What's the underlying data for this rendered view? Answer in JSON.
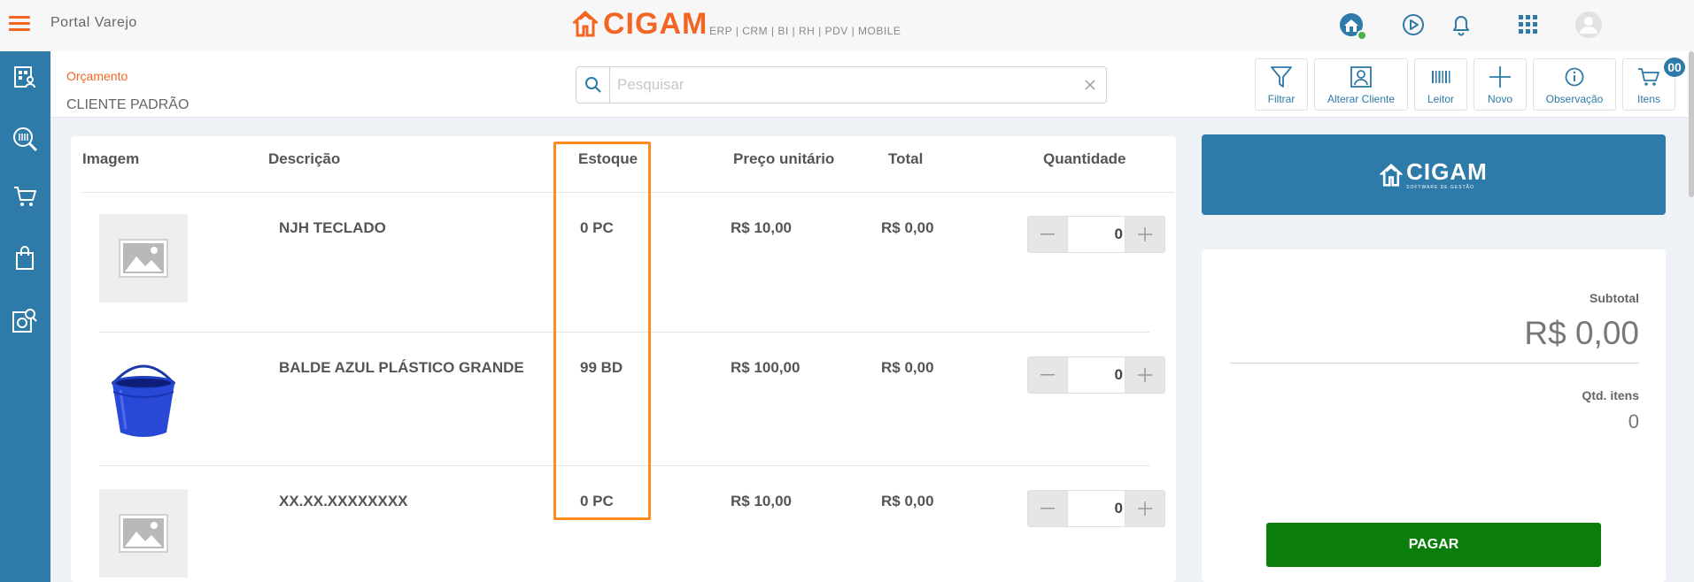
{
  "header": {
    "portal_title": "Portal Varejo",
    "brand_name": "CIGAM",
    "brand_modules": "ERP | CRM | BI | RH | PDV | MOBILE",
    "brand_color": "#f26522"
  },
  "sidebar": {
    "color": "#2e7aa8",
    "items": [
      {
        "icon": "clients-icon"
      },
      {
        "icon": "barcode-search-icon"
      },
      {
        "icon": "cart-icon"
      },
      {
        "icon": "shopping-bag-icon"
      },
      {
        "icon": "document-search-icon"
      }
    ]
  },
  "document": {
    "type": "Orçamento",
    "client": "CLIENTE PADRÃO"
  },
  "search": {
    "placeholder": "Pesquisar",
    "value": ""
  },
  "toolbar": {
    "buttons": [
      {
        "label": "Filtrar",
        "icon": "filter-icon"
      },
      {
        "label": "Alterar Cliente",
        "icon": "user-card-icon"
      },
      {
        "label": "Leitor",
        "icon": "barcode-icon"
      },
      {
        "label": "Novo",
        "icon": "plus-icon"
      },
      {
        "label": "Observação",
        "icon": "info-icon"
      },
      {
        "label": "Itens",
        "icon": "cart-icon"
      }
    ],
    "cart_count": "00"
  },
  "table": {
    "columns": [
      "Imagem",
      "Descrição",
      "Estoque",
      "Preço unitário",
      "Total",
      "Quantidade"
    ],
    "rows": [
      {
        "image": "placeholder",
        "description": "NJH TECLADO",
        "stock": "0 PC",
        "unit_price": "R$ 10,00",
        "total": "R$ 0,00",
        "quantity": "0"
      },
      {
        "image": "blue-bucket",
        "description": "BALDE AZUL PLÁSTICO GRANDE",
        "stock": "99 BD",
        "unit_price": "R$ 100,00",
        "total": "R$ 0,00",
        "quantity": "0"
      },
      {
        "image": "placeholder",
        "description": "XX.XX.XXXXXXXX",
        "stock": "0 PC",
        "unit_price": "R$ 10,00",
        "total": "R$ 0,00",
        "quantity": "0"
      }
    ]
  },
  "summary": {
    "logo_name": "CIGAM",
    "logo_subtitle": "SOFTWARE DE GESTÃO",
    "subtotal_label": "Subtotal",
    "subtotal_value": "R$ 0,00",
    "items_label": "Qtd. itens",
    "items_value": "0",
    "pay_label": "PAGAR",
    "pay_color": "#0a7d0a"
  },
  "highlight_color": "#ff8a1f"
}
